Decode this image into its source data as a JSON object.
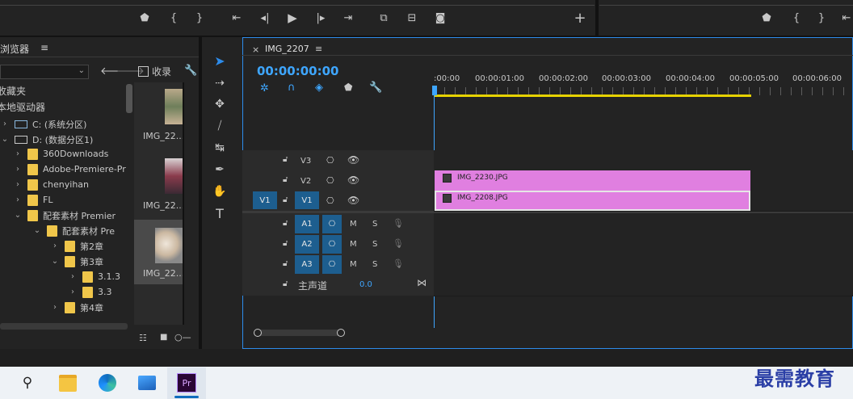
{
  "project_panel": {
    "title": "媒体浏览器",
    "title_visible": "浏览器",
    "favorites": "收藏夹",
    "local_drives": "本地驱动器",
    "collect_label": "收录",
    "tree": [
      {
        "label": "C: (系统分区)",
        "type": "drive"
      },
      {
        "label": "D: (数据分区1)",
        "type": "drive"
      },
      {
        "label": "360Downloads",
        "type": "folder"
      },
      {
        "label": "Adobe-Premiere-Pr",
        "type": "folder"
      },
      {
        "label": "chenyihan",
        "type": "folder"
      },
      {
        "label": "FL",
        "type": "folder"
      },
      {
        "label": "配套素材 Premier",
        "type": "folder"
      },
      {
        "label": "配套素材 Pre",
        "type": "folder"
      },
      {
        "label": "第2章",
        "type": "folder"
      },
      {
        "label": "第3章",
        "type": "folder"
      },
      {
        "label": "3.1.3",
        "type": "folder"
      },
      {
        "label": "3.3",
        "type": "folder"
      },
      {
        "label": "第4章",
        "type": "folder"
      }
    ],
    "thumbnails": [
      "IMG_22...",
      "IMG_22...",
      "IMG_22..."
    ]
  },
  "timeline": {
    "tab_name": "IMG_2207",
    "timecode": "00:00:00:00",
    "ruler": [
      ":00:00",
      "00:00:01:00",
      "00:00:02:00",
      "00:00:03:00",
      "00:00:04:00",
      "00:00:05:00",
      "00:00:06:00"
    ],
    "video_tracks": [
      "V3",
      "V2",
      "V1"
    ],
    "source_patch": "V1",
    "audio_tracks": [
      "A1",
      "A2",
      "A3"
    ],
    "mute": "M",
    "solo": "S",
    "master_label": "主声道",
    "master_value": "0.0",
    "clips": [
      {
        "name": "IMG_2230.JPG",
        "track": "V2"
      },
      {
        "name": "IMG_2208.JPG",
        "track": "V1"
      }
    ]
  },
  "watermark": "最需教育",
  "colors": {
    "accent": "#2d8ceb",
    "clip": "#e07fe0",
    "folder": "#f0c64a",
    "track_active": "#1d5e8f"
  }
}
